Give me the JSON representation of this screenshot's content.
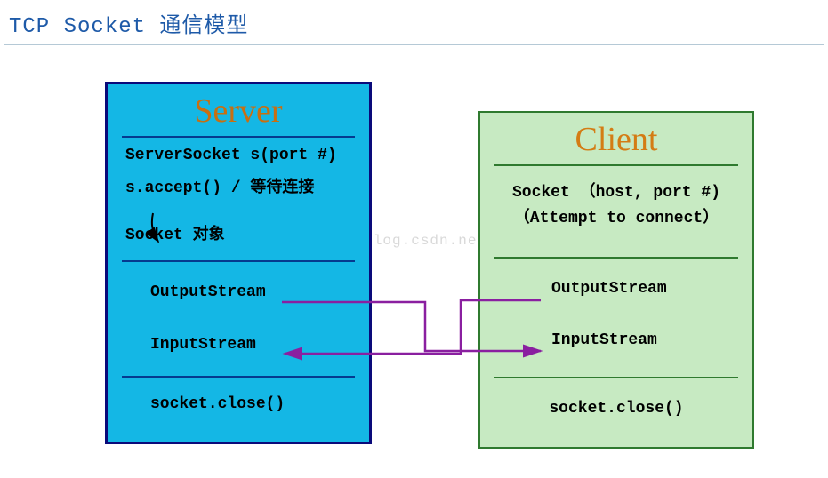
{
  "title": "TCP Socket 通信模型",
  "watermark": "http://blog.csdn.net/robbyo",
  "server": {
    "title": "Server",
    "line1": "ServerSocket s(port #)",
    "line2": "s.accept() / 等待连接",
    "line3": "Socket 对象",
    "out": "OutputStream",
    "in": "InputStream",
    "close": "socket.close()"
  },
  "client": {
    "title": "Client",
    "line1": "Socket （host, port #)",
    "line2": "（Attempt to connect）",
    "out": "OutputStream",
    "in": "InputStream",
    "close": "socket.close()"
  },
  "chart_data": {
    "type": "diagram",
    "title": "TCP Socket 通信模型",
    "nodes": [
      {
        "id": "server",
        "label": "Server",
        "steps": [
          "ServerSocket s(port #)",
          "s.accept() / 等待连接",
          "Socket 对象",
          "OutputStream",
          "InputStream",
          "socket.close()"
        ]
      },
      {
        "id": "client",
        "label": "Client",
        "steps": [
          "Socket （host, port #)",
          "（Attempt to connect）",
          "OutputStream",
          "InputStream",
          "socket.close()"
        ]
      }
    ],
    "edges": [
      {
        "from": "server.s.accept()",
        "to": "server.Socket 对象",
        "type": "internal-arrow"
      },
      {
        "from": "server.OutputStream",
        "to": "client.InputStream",
        "type": "purple-connector"
      },
      {
        "from": "client.OutputStream",
        "to": "server.InputStream",
        "type": "purple-connector"
      }
    ]
  }
}
